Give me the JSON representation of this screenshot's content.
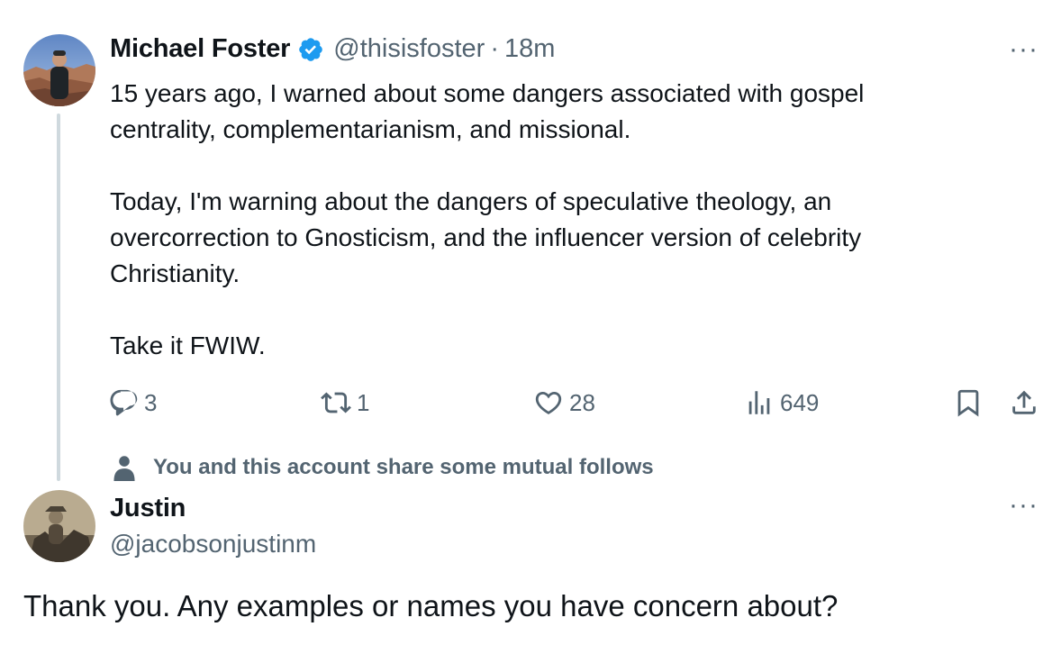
{
  "tweet": {
    "author_name": "Michael Foster",
    "handle": "@thisisfoster",
    "separator": "·",
    "time": "18m",
    "lines": [
      "15 years ago, I warned about some dangers associated with gospel",
      "centrality, complementarianism, and missional.",
      "",
      "Today, I'm warning about the dangers of speculative theology, an",
      "overcorrection to Gnosticism, and the influencer version of celebrity",
      "Christianity.",
      "",
      "Take it FWIW."
    ],
    "more_label": "···",
    "actions": {
      "replies": "3",
      "reposts": "1",
      "likes": "28",
      "views": "649"
    },
    "icons": [
      "verified-badge-icon",
      "reply-icon",
      "repost-icon",
      "like-icon",
      "views-icon",
      "bookmark-icon",
      "share-icon"
    ]
  },
  "mutual_notice": "You and this account share some mutual follows",
  "reply": {
    "author_name": "Justin",
    "handle": "@jacobsonjustinm",
    "more_label": "···",
    "text": "Thank you. Any examples or names you have concern about?"
  },
  "colors": {
    "verified": "#1d9bf0",
    "text": "#0f1419",
    "secondary": "#536471",
    "thread_line": "#cfd9de"
  }
}
